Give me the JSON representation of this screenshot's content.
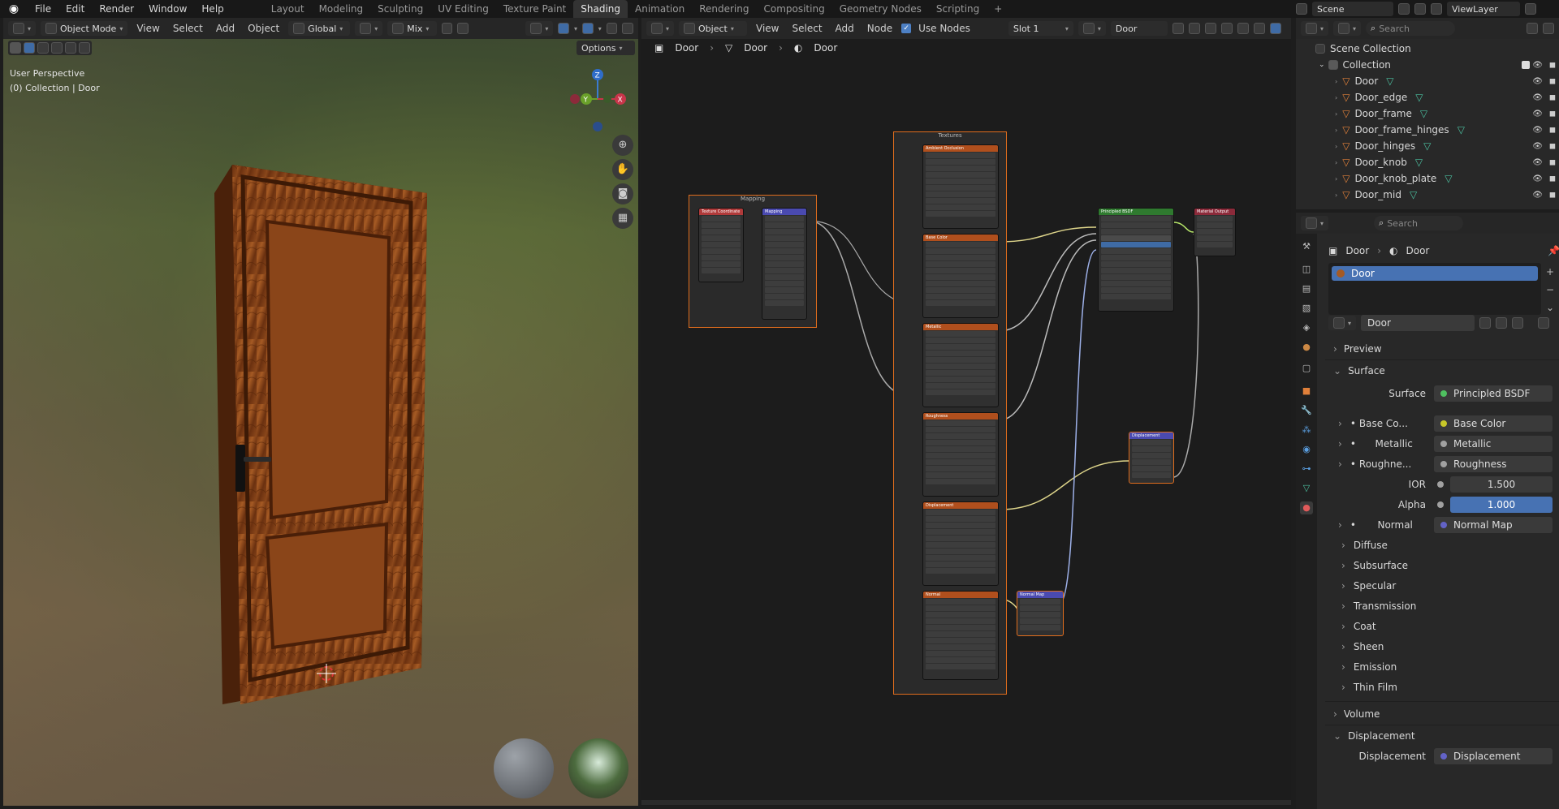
{
  "topbar": {
    "menus": [
      "File",
      "Edit",
      "Render",
      "Window",
      "Help"
    ],
    "workspaces": [
      "Layout",
      "Modeling",
      "Sculpting",
      "UV Editing",
      "Texture Paint",
      "Shading",
      "Animation",
      "Rendering",
      "Compositing",
      "Geometry Nodes",
      "Scripting",
      "+"
    ],
    "active_workspace": "Shading",
    "scene": "Scene",
    "view_layer": "ViewLayer"
  },
  "viewport_header": {
    "mode": "Object Mode",
    "menus": [
      "View",
      "Select",
      "Add",
      "Object"
    ],
    "transform": "Global",
    "pivot": "Mix",
    "options": "Options"
  },
  "viewport": {
    "perspective_label": "User Perspective",
    "collection_label": "(0) Collection | Door",
    "gizmo": {
      "z": "Z",
      "y": "Y",
      "x": "X"
    }
  },
  "node_header": {
    "type": "Object",
    "menus": [
      "View",
      "Select",
      "Add",
      "Node"
    ],
    "use_nodes_label": "Use Nodes",
    "slot": "Slot 1",
    "material": "Door"
  },
  "breadcrumb": [
    "Door",
    "Door",
    "Door"
  ],
  "nodes": {
    "mapping_frame": "Mapping",
    "textures_frame": "Textures",
    "tex_coord": "Texture Coordinate",
    "mapping": "Mapping",
    "ambient": "Ambient Occlusion",
    "base_color": "Base Color",
    "metallic": "Metallic",
    "roughness": "Roughness",
    "displacement": "Displacement",
    "normal": "Normal",
    "principled": "Principled BSDF",
    "output": "Material Output",
    "disp_node": "Displacement",
    "normal_map": "Normal Map"
  },
  "outliner": {
    "search_placeholder": "Search",
    "scene_collection": "Scene Collection",
    "collection": "Collection",
    "items": [
      "Door",
      "Door_edge",
      "Door_frame",
      "Door_frame_hinges",
      "Door_hinges",
      "Door_knob",
      "Door_knob_plate",
      "Door_mid"
    ]
  },
  "properties": {
    "search_placeholder": "Search",
    "breadcrumb_object": "Door",
    "breadcrumb_material": "Door",
    "material_slot": "Door",
    "material_name": "Door",
    "preview": "Preview",
    "surface_section": "Surface",
    "surface_label": "Surface",
    "surface_value": "Principled BSDF",
    "rows": [
      {
        "label": "Base Co...",
        "value": "Base Color",
        "color": "#c7c729"
      },
      {
        "label": "Metallic",
        "value": "Metallic",
        "color": "#a1a1a1"
      },
      {
        "label": "Roughne...",
        "value": "Roughness",
        "color": "#a1a1a1"
      }
    ],
    "ior_label": "IOR",
    "ior_value": "1.500",
    "alpha_label": "Alpha",
    "alpha_value": "1.000",
    "normal_label": "Normal",
    "normal_value": "Normal Map",
    "subpanels": [
      "Diffuse",
      "Subsurface",
      "Specular",
      "Transmission",
      "Coat",
      "Sheen",
      "Emission",
      "Thin Film"
    ],
    "volume": "Volume",
    "displacement_section": "Displacement",
    "displacement_label": "Displacement",
    "displacement_value": "Displacement"
  }
}
